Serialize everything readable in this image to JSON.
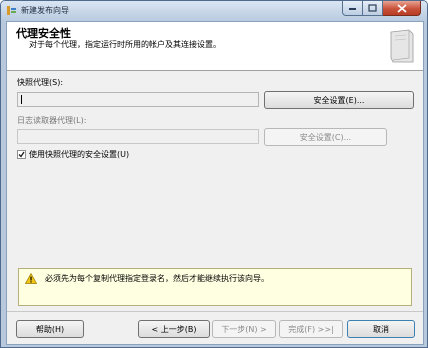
{
  "window": {
    "title": "新建发布向导"
  },
  "header": {
    "title": "代理安全性",
    "subtitle": "对于每个代理，指定运行时所用的帐户及其连接设置。"
  },
  "snapshot_agent": {
    "label": "快照代理(S):",
    "value": "",
    "button": "安全设置(E)..."
  },
  "log_reader_agent": {
    "label": "日志读取器代理(L):",
    "value": "",
    "button": "安全设置(C)..."
  },
  "use_snapshot_security": {
    "label": "使用快照代理的安全设置(U)",
    "checked": true
  },
  "warning": {
    "text": "必须先为每个复制代理指定登录名，然后才能继续执行该向导。"
  },
  "footer": {
    "help": "帮助(H)",
    "back": "< 上一步(B)",
    "next": "下一步(N) >",
    "finish": "完成(F) >>|",
    "cancel": "取消"
  },
  "colors": {
    "warning_bg": "#ffffe1",
    "title_bar": "#b9cbe0",
    "close_button": "#c9523a"
  }
}
